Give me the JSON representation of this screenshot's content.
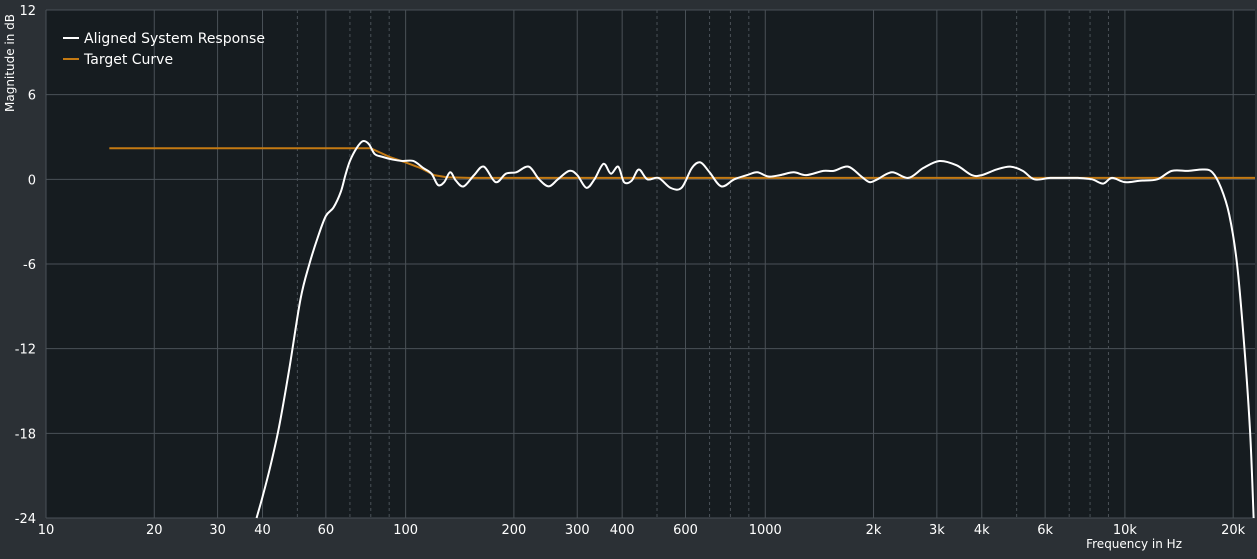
{
  "chart_data": {
    "type": "line",
    "xscale": "log",
    "xlim": [
      10,
      23000
    ],
    "ylim": [
      -24,
      12
    ],
    "xlabel": "Frequency in Hz",
    "ylabel": "Magnitude in dB",
    "grid": true,
    "legend_position": "top-left",
    "x_ticks": [
      {
        "value": 10,
        "label": "10"
      },
      {
        "value": 20,
        "label": "20"
      },
      {
        "value": 30,
        "label": "30"
      },
      {
        "value": 40,
        "label": "40"
      },
      {
        "value": 60,
        "label": "60"
      },
      {
        "value": 100,
        "label": "100"
      },
      {
        "value": 200,
        "label": "200"
      },
      {
        "value": 300,
        "label": "300"
      },
      {
        "value": 400,
        "label": "400"
      },
      {
        "value": 600,
        "label": "600"
      },
      {
        "value": 1000,
        "label": "1000"
      },
      {
        "value": 2000,
        "label": "2k"
      },
      {
        "value": 3000,
        "label": "3k"
      },
      {
        "value": 4000,
        "label": "4k"
      },
      {
        "value": 6000,
        "label": "6k"
      },
      {
        "value": 10000,
        "label": "10k"
      },
      {
        "value": 20000,
        "label": "20k"
      }
    ],
    "x_minor_gridlines": [
      50,
      70,
      80,
      90,
      500,
      700,
      800,
      900,
      5000,
      7000,
      8000,
      9000
    ],
    "y_ticks": [
      {
        "value": 12,
        "label": "12"
      },
      {
        "value": 6,
        "label": "6"
      },
      {
        "value": 0,
        "label": "0"
      },
      {
        "value": -6,
        "label": "-6"
      },
      {
        "value": -12,
        "label": "-12"
      },
      {
        "value": -18,
        "label": "-18"
      },
      {
        "value": -24,
        "label": "-24"
      }
    ],
    "series": [
      {
        "name": "Aligned System Response",
        "color": "#ffffff",
        "points": [
          [
            38.5,
            -24
          ],
          [
            40,
            -22.5
          ],
          [
            42,
            -20.4
          ],
          [
            44.5,
            -17.5
          ],
          [
            47.5,
            -13.4
          ],
          [
            51,
            -8.5
          ],
          [
            54,
            -6.0
          ],
          [
            57,
            -4.1
          ],
          [
            60,
            -2.6
          ],
          [
            63,
            -2.0
          ],
          [
            66,
            -0.9
          ],
          [
            68,
            0.3
          ],
          [
            70,
            1.3
          ],
          [
            73,
            2.2
          ],
          [
            76,
            2.7
          ],
          [
            79,
            2.5
          ],
          [
            82,
            1.8
          ],
          [
            86,
            1.6
          ],
          [
            92,
            1.4
          ],
          [
            98,
            1.3
          ],
          [
            105,
            1.3
          ],
          [
            112,
            0.8
          ],
          [
            118,
            0.4
          ],
          [
            123,
            -0.4
          ],
          [
            128,
            -0.2
          ],
          [
            133,
            0.5
          ],
          [
            138,
            -0.1
          ],
          [
            145,
            -0.5
          ],
          [
            155,
            0.3
          ],
          [
            165,
            0.9
          ],
          [
            178,
            -0.2
          ],
          [
            190,
            0.4
          ],
          [
            203,
            0.5
          ],
          [
            220,
            0.9
          ],
          [
            235,
            0.0
          ],
          [
            250,
            -0.5
          ],
          [
            265,
            0.0
          ],
          [
            285,
            0.6
          ],
          [
            300,
            0.3
          ],
          [
            318,
            -0.6
          ],
          [
            335,
            0.0
          ],
          [
            355,
            1.1
          ],
          [
            372,
            0.4
          ],
          [
            390,
            0.9
          ],
          [
            405,
            -0.2
          ],
          [
            425,
            -0.1
          ],
          [
            445,
            0.7
          ],
          [
            470,
            0.0
          ],
          [
            505,
            0.1
          ],
          [
            545,
            -0.6
          ],
          [
            585,
            -0.6
          ],
          [
            625,
            0.8
          ],
          [
            660,
            1.2
          ],
          [
            700,
            0.5
          ],
          [
            755,
            -0.5
          ],
          [
            820,
            0.0
          ],
          [
            890,
            0.3
          ],
          [
            950,
            0.5
          ],
          [
            1020,
            0.2
          ],
          [
            1100,
            0.3
          ],
          [
            1200,
            0.5
          ],
          [
            1300,
            0.3
          ],
          [
            1450,
            0.6
          ],
          [
            1550,
            0.6
          ],
          [
            1700,
            0.9
          ],
          [
            1850,
            0.2
          ],
          [
            1950,
            -0.2
          ],
          [
            2050,
            0.0
          ],
          [
            2250,
            0.5
          ],
          [
            2500,
            0.1
          ],
          [
            2750,
            0.8
          ],
          [
            3050,
            1.3
          ],
          [
            3400,
            1.0
          ],
          [
            3750,
            0.3
          ],
          [
            4000,
            0.3
          ],
          [
            4400,
            0.7
          ],
          [
            4800,
            0.9
          ],
          [
            5200,
            0.6
          ],
          [
            5600,
            0.0
          ],
          [
            6200,
            0.1
          ],
          [
            6900,
            0.1
          ],
          [
            7400,
            0.1
          ],
          [
            8100,
            0.0
          ],
          [
            8700,
            -0.3
          ],
          [
            9200,
            0.1
          ],
          [
            10000,
            -0.2
          ],
          [
            11000,
            -0.1
          ],
          [
            12300,
            0.0
          ],
          [
            13500,
            0.6
          ],
          [
            15000,
            0.6
          ],
          [
            16500,
            0.7
          ],
          [
            17500,
            0.5
          ],
          [
            18500,
            -0.6
          ],
          [
            19500,
            -2.5
          ],
          [
            20500,
            -6.0
          ],
          [
            21500,
            -12.0
          ],
          [
            22300,
            -18.0
          ],
          [
            22800,
            -24.0
          ]
        ]
      },
      {
        "name": "Target Curve",
        "color": "#c47a13",
        "points": [
          [
            15,
            2.2
          ],
          [
            70,
            2.2
          ],
          [
            80,
            2.2
          ],
          [
            90,
            1.6
          ],
          [
            100,
            1.2
          ],
          [
            110,
            0.8
          ],
          [
            120,
            0.3
          ],
          [
            130,
            0.15
          ],
          [
            150,
            0.1
          ],
          [
            23000,
            0.1
          ]
        ]
      }
    ]
  }
}
